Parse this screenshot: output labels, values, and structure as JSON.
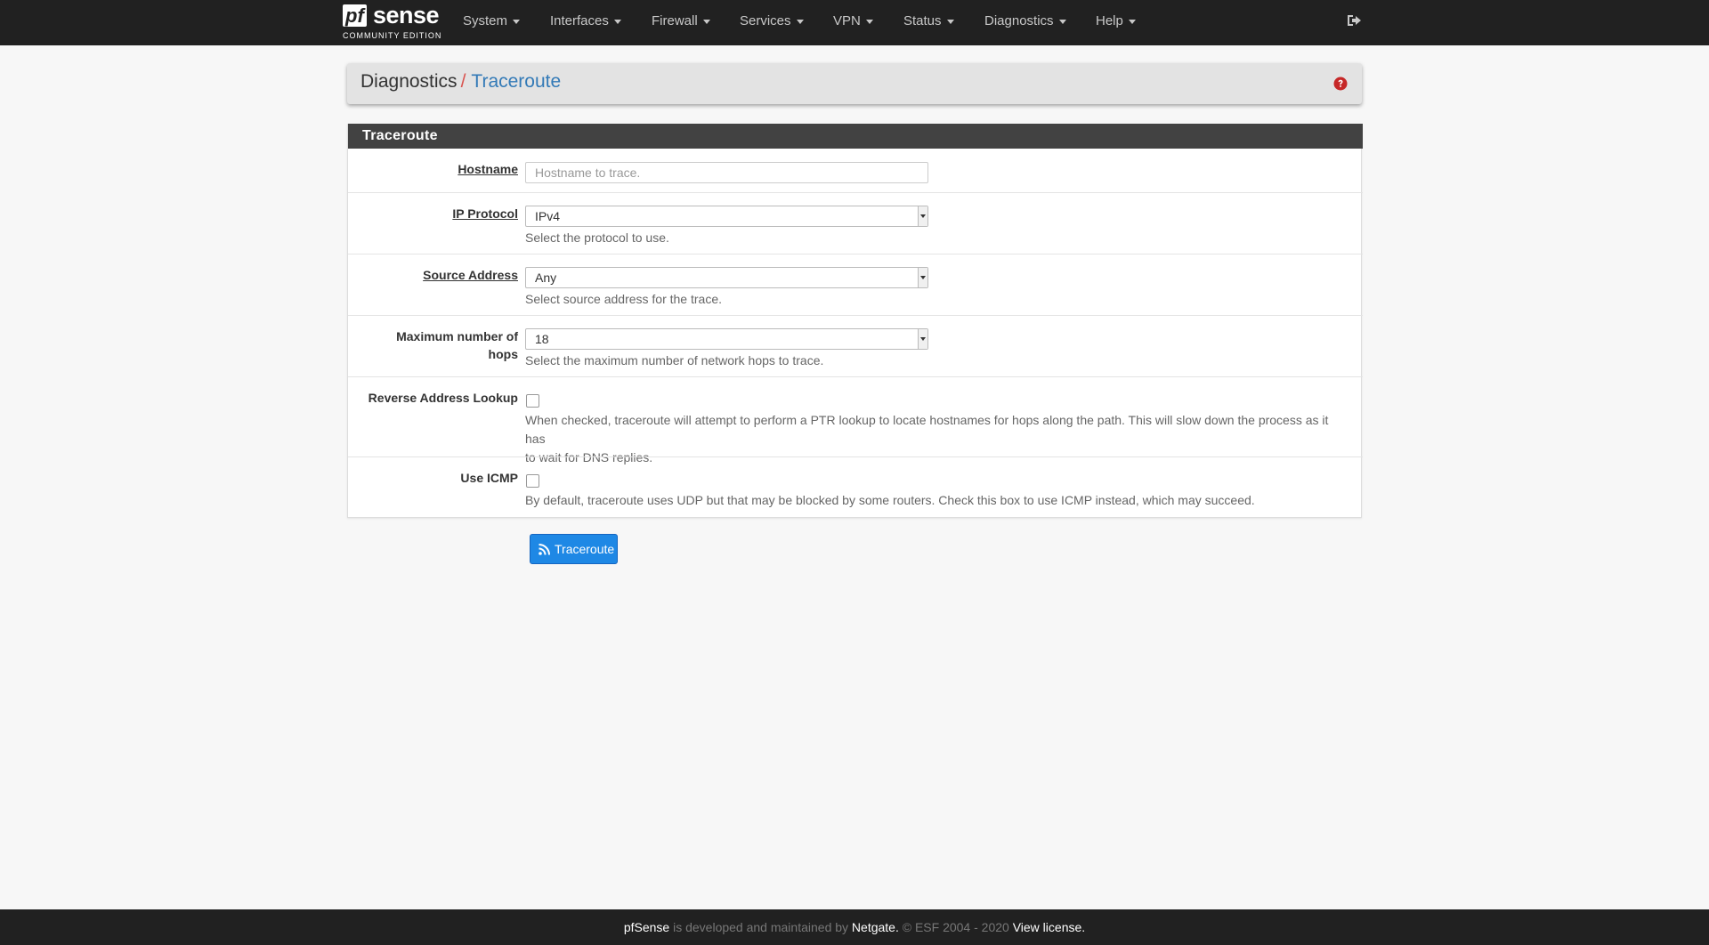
{
  "navbar": {
    "brand_pf": "pf",
    "brand_sense": "sense",
    "brand_edition": "COMMUNITY EDITION",
    "menu": [
      {
        "label": "System"
      },
      {
        "label": "Interfaces"
      },
      {
        "label": "Firewall"
      },
      {
        "label": "Services"
      },
      {
        "label": "VPN"
      },
      {
        "label": "Status"
      },
      {
        "label": "Diagnostics"
      },
      {
        "label": "Help"
      }
    ],
    "logout_icon": "sign-out-icon"
  },
  "breadcrumb": {
    "root": "Diagnostics",
    "separator": "/",
    "current": "Traceroute",
    "help_icon": "question-circle-icon"
  },
  "panel": {
    "title": "Traceroute",
    "fields": {
      "hostname": {
        "label": "Hostname",
        "value": "",
        "placeholder": "Hostname to trace."
      },
      "ip_protocol": {
        "label": "IP Protocol",
        "value": "IPv4",
        "help": "Select the protocol to use."
      },
      "source_address": {
        "label": "Source Address",
        "value": "Any",
        "help": "Select source address for the trace."
      },
      "max_hops": {
        "label_line1": "Maximum number of",
        "label_line2": "hops",
        "value": "18",
        "help": "Select the maximum number of network hops to trace."
      },
      "reverse_lookup": {
        "label": "Reverse Address Lookup",
        "checked": false,
        "help_line1": "When checked, traceroute will attempt to perform a PTR lookup to locate hostnames for hops along the path. This will slow down the process as it has",
        "help_line2": "to wait for DNS replies."
      },
      "use_icmp": {
        "label": "Use ICMP",
        "checked": false,
        "help": "By default, traceroute uses UDP but that may be blocked by some routers. Check this box to use ICMP instead, which may succeed."
      }
    }
  },
  "button": {
    "label": "Traceroute",
    "icon": "rss-icon"
  },
  "footer": {
    "product": "pfSense",
    "text1": " is developed and maintained by ",
    "company": "Netgate.",
    "text2": " © ESF 2004 - 2020 ",
    "license": "View license."
  },
  "colors": {
    "navbar": "#212121",
    "panel_heading": "#424242",
    "accent_blue": "#337ab7",
    "button_blue": "#1e88e5",
    "separator_red": "#d9534f",
    "help_red": "#c62828"
  }
}
